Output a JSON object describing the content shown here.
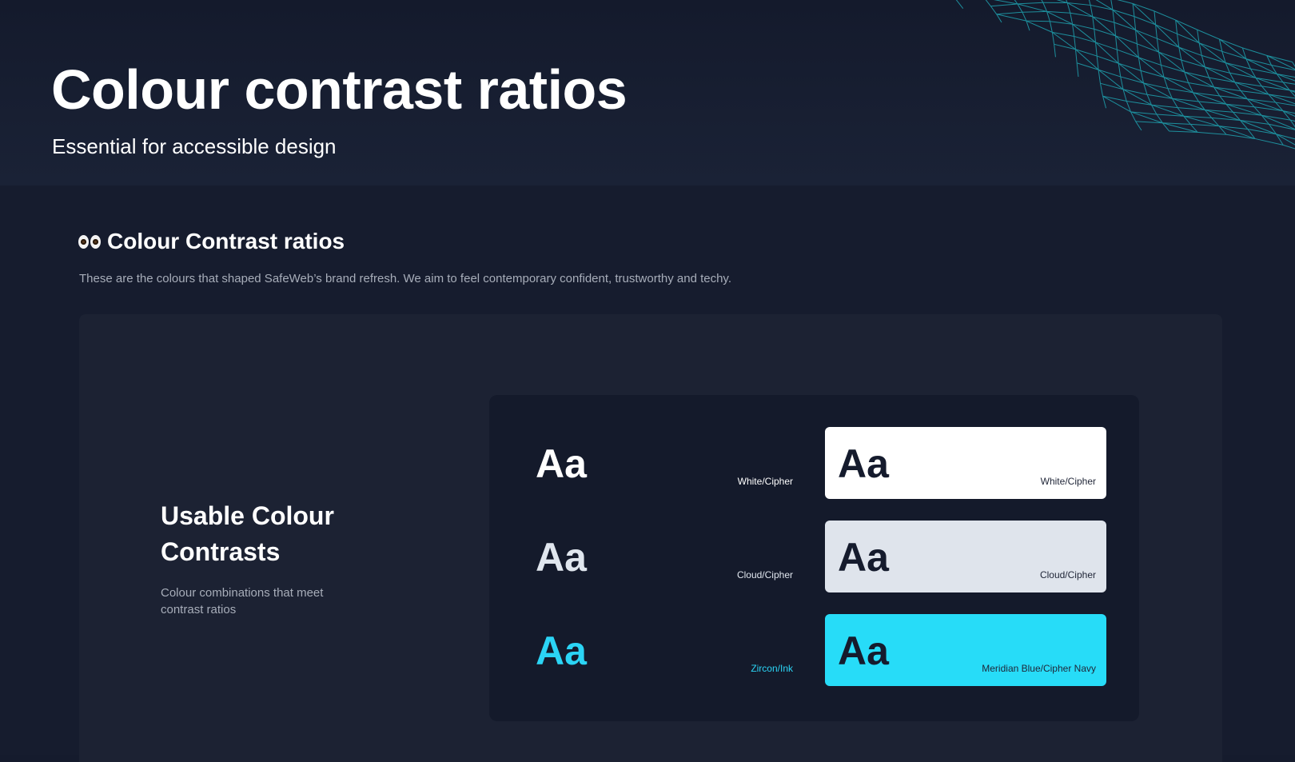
{
  "hero": {
    "title": "Colour contrast ratios",
    "subtitle": "Essential for accessible design"
  },
  "section": {
    "heading": "Colour Contrast ratios",
    "description": "These are the colours that shaped SafeWeb’s brand refresh. We aim to feel contemporary confident, trustworthy and techy."
  },
  "panel": {
    "title": "Usable Colour Contrasts",
    "description": "Colour combinations that meet contrast ratios"
  },
  "contrast_rows": [
    {
      "sample": "Aa",
      "dark_label": "White/Cipher",
      "dark_text_color": "#ffffff",
      "chip_label": "White/Cipher",
      "chip_color": "#ffffff"
    },
    {
      "sample": "Aa",
      "dark_label": "Cloud/Cipher",
      "dark_text_color": "#e0e6ee",
      "chip_label": "Cloud/Cipher",
      "chip_color": "#dfe4ec"
    },
    {
      "sample": "Aa",
      "dark_label": "Zircon/Ink",
      "dark_text_color": "#2bd4f5",
      "chip_label": "Meridian Blue/Cipher Navy",
      "chip_color": "#27dcf8"
    }
  ],
  "colors": {
    "background": "#151b2d",
    "panel": "#1c2233",
    "card": "#141a2b",
    "accent": "#27dcf8",
    "mesh": "#1fa3b0"
  },
  "icons": {
    "heading_icon": "eyes-emoji-icon",
    "decoration": "wireframe-mesh-icon"
  }
}
